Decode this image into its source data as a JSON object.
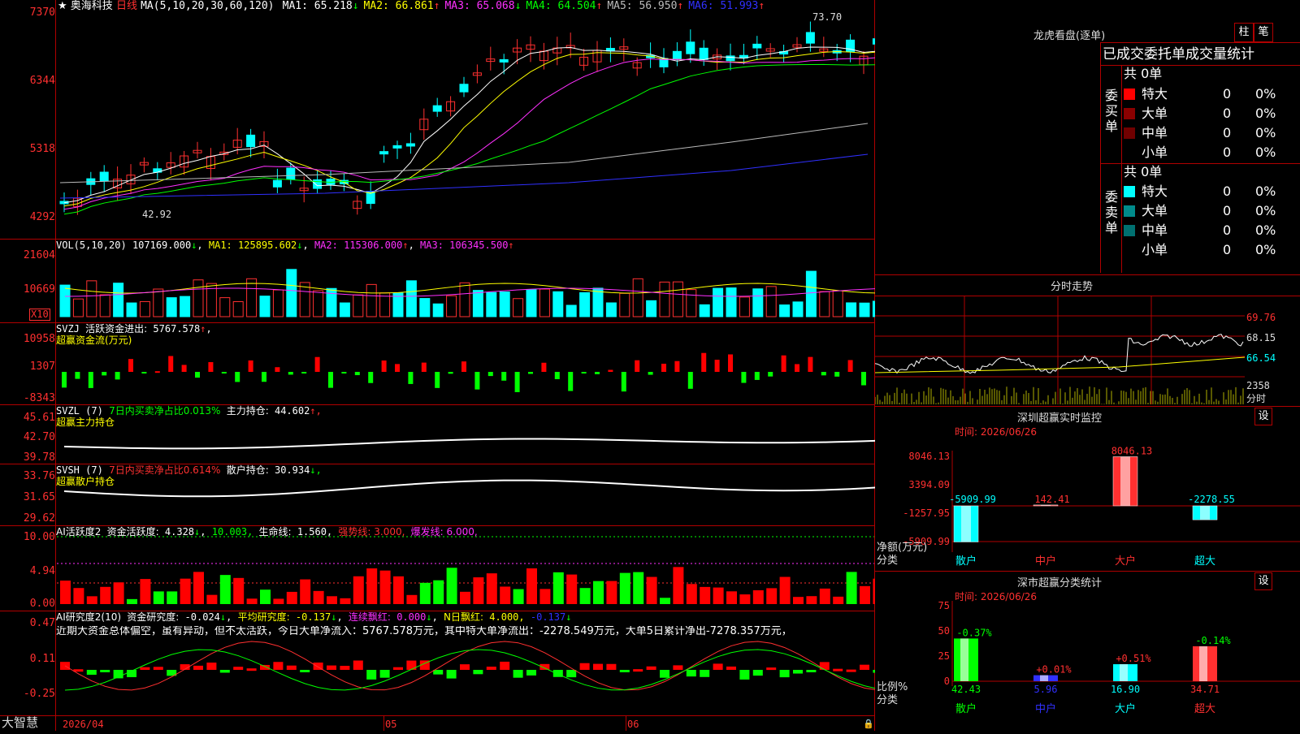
{
  "main": {
    "stock_name": "奥海科技",
    "period": "日线",
    "ma_params": "MA(5,10,20,30,60,120)",
    "ma": [
      {
        "label": "MA1:",
        "value": "65.218",
        "arrow": "↓",
        "color": "#ffffff"
      },
      {
        "label": "MA2:",
        "value": "66.861",
        "arrow": "↑",
        "color": "#ffff00"
      },
      {
        "label": "MA3:",
        "value": "65.068",
        "arrow": "↓",
        "color": "#ff30ff"
      },
      {
        "label": "MA4:",
        "value": "64.504",
        "arrow": "↑",
        "color": "#00ff00"
      },
      {
        "label": "MA5:",
        "value": "56.950",
        "arrow": "↑",
        "color": "#bbbbbb"
      },
      {
        "label": "MA6:",
        "value": "51.993",
        "arrow": "↑",
        "color": "#3030ff"
      }
    ],
    "axis": [
      "7370",
      "6344",
      "5318",
      "4292"
    ],
    "high_note": "73.70",
    "low_note": "42.92"
  },
  "vol": {
    "params": "VOL(5,10,20)",
    "value": "107169.000",
    "arrow": "↓",
    "ma1": "125895.602",
    "ma2": "115306.000",
    "ma3": "106345.500",
    "ma1_label": "MA1:",
    "ma2_label": "MA2:",
    "ma3_label": "MA3:",
    "axis": [
      "21604",
      "10669"
    ],
    "multiplier": "X10"
  },
  "svzj": {
    "name": "SVZJ",
    "desc": "活跃资金进出:",
    "value": "5767.578",
    "arrow": "↑",
    "sub": "超赢资金流(万元)",
    "axis": [
      "10958",
      "1307",
      "-8343"
    ]
  },
  "svzl": {
    "name": "SVZL",
    "param": "(7)",
    "desc": "7日内买卖净占比0.013%",
    "label": "主力持仓:",
    "value": "44.602",
    "arrow": "↑,",
    "sub": "超赢主力持仓",
    "axis": [
      "45.61",
      "42.70",
      "39.78"
    ]
  },
  "svsh": {
    "name": "SVSH",
    "param": "(7)",
    "desc": "7日内买卖净占比0.614%",
    "label": "散户持仓:",
    "value": "30.934",
    "arrow": "↓,",
    "sub": "超赢散户持仓",
    "axis": [
      "33.76",
      "31.65",
      "29.62"
    ]
  },
  "ai1": {
    "name": "AI活跃度2",
    "label": "资金活跃度:",
    "value": "4.328",
    "v2": "10.003,",
    "life_label": "生命线:",
    "life": "1.560,",
    "strong": "强势线: 3.000,",
    "burst": "爆发线: 6.000,",
    "axis": [
      "10.00",
      "4.94",
      "0.00"
    ]
  },
  "ai2": {
    "name": "AI研究度2(10)",
    "label": "资金研究度:",
    "value": "-0.024",
    "avg_label": "平均研究度:",
    "avg": "-0.137",
    "red_label": "连续飘红:",
    "red": "0.000",
    "nred_label": "N日飘红:",
    "nred": "4.000,",
    "nred2": "-0.137",
    "comment": "近期大资金总体偏空，虽有异动，但不太活跃，今日大单净流入：5767.578万元，其中特大单净流出：-2278.549万元，大单5日累计净出-7278.357万元，",
    "axis": [
      "0.47",
      "0.11",
      "-0.25"
    ]
  },
  "footer": {
    "brand": "大智慧",
    "date": "2026/04",
    "m05": "05",
    "m06": "06"
  },
  "side": {
    "title": "龙虎看盘(逐单)",
    "btn_bar": "柱",
    "btn_pen": "笔",
    "table_header": "已成交委托单成交量统计",
    "buy": {
      "vertical": "委买单",
      "total": "共 0单",
      "rows": [
        {
          "name": "特大",
          "count": "0",
          "pct": "0%",
          "color": "#ff0000"
        },
        {
          "name": "大单",
          "count": "0",
          "pct": "0%",
          "color": "#8b0000"
        },
        {
          "name": "中单",
          "count": "0",
          "pct": "0%",
          "color": "#700000"
        },
        {
          "name": "小单",
          "count": "0",
          "pct": "0%",
          "color": "#000000"
        }
      ]
    },
    "sell": {
      "vertical": "委卖单",
      "total": "共 0单",
      "rows": [
        {
          "name": "特大",
          "count": "0",
          "pct": "0%",
          "color": "#00ffff"
        },
        {
          "name": "大单",
          "count": "0",
          "pct": "0%",
          "color": "#008b8b"
        },
        {
          "name": "中单",
          "count": "0",
          "pct": "0%",
          "color": "#007070"
        },
        {
          "name": "小单",
          "count": "0",
          "pct": "0%",
          "color": "#000000"
        }
      ]
    },
    "intraday": {
      "title": "分时走势",
      "axis": [
        "69.76",
        "68.15",
        "66.54"
      ],
      "vol_axis": "2358",
      "vol_label": "分时"
    },
    "monitor": {
      "title": "深圳超赢实时监控",
      "btn": "设",
      "time_label": "时间:",
      "time": "2026/06/26",
      "axis": [
        "8046.13",
        "3394.09",
        "-1257.95",
        "-5909.99"
      ],
      "unit": "净额(万元)",
      "class_label": "分类",
      "bars": [
        {
          "name": "散户",
          "value": "-5909.99",
          "num": -5909.99,
          "color": "#00ffff"
        },
        {
          "name": "中户",
          "value": "142.41",
          "num": 142.41,
          "color": "#ff3030"
        },
        {
          "name": "大户",
          "value": "8046.13",
          "num": 8046.13,
          "color": "#ff3030"
        },
        {
          "name": "超大",
          "value": "-2278.55",
          "num": -2278.55,
          "color": "#00ffff"
        }
      ]
    },
    "classstat": {
      "title": "深市超赢分类统计",
      "btn": "设",
      "time_label": "时间:",
      "time": "2026/06/26",
      "axis": [
        "75",
        "50",
        "25",
        "0"
      ],
      "unit": "比例%",
      "class_label": "分类",
      "bars": [
        {
          "name": "散户",
          "value": "42.43",
          "num": 42.43,
          "delta": "-0.37%",
          "delta_color": "#00ff00",
          "color": "#00ff00",
          "name_color": "#00ff00"
        },
        {
          "name": "中户",
          "value": "5.96",
          "num": 5.96,
          "delta": "+0.01%",
          "delta_color": "#ff3030",
          "color": "#3030ff",
          "name_color": "#3030ff"
        },
        {
          "name": "大户",
          "value": "16.90",
          "num": 16.9,
          "delta": "+0.51%",
          "delta_color": "#ff3030",
          "color": "#00ffff",
          "name_color": "#00ffff"
        },
        {
          "name": "超大",
          "value": "34.71",
          "num": 34.71,
          "delta": "-0.14%",
          "delta_color": "#00ff00",
          "color": "#ff3030",
          "name_color": "#ff3030"
        }
      ]
    }
  }
}
